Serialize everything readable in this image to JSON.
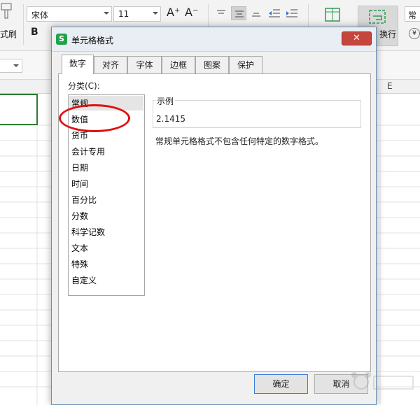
{
  "ribbon": {
    "format_painter_label": "式刷",
    "font_name": "宋体",
    "font_size": "11",
    "grow_font": "A⁺",
    "shrink_font": "A⁻",
    "bold": "B",
    "wrap_label": "换行",
    "number_format": "常"
  },
  "sheet": {
    "column_e": "E"
  },
  "dialog": {
    "title": "单元格格式",
    "app_icon_letter": "S",
    "close_glyph": "✕",
    "tabs": [
      "数字",
      "对齐",
      "字体",
      "边框",
      "图案",
      "保护"
    ],
    "active_tab": "数字",
    "category_label": "分类(C):",
    "categories": [
      "常规",
      "数值",
      "货币",
      "会计专用",
      "日期",
      "时间",
      "百分比",
      "分数",
      "科学记数",
      "文本",
      "特殊",
      "自定义"
    ],
    "selected_category": "常规",
    "highlighted_category": "数值",
    "sample_label": "示例",
    "sample_value": "2.1415",
    "description": "常规单元格格式不包含任何特定的数字格式。",
    "ok_label": "确定",
    "cancel_label": "取消"
  },
  "colors": {
    "annotation_red": "#e01010",
    "selection_green": "#2e7d32",
    "close_red": "#c6463e",
    "ok_focus_border": "#3a7bd5"
  }
}
